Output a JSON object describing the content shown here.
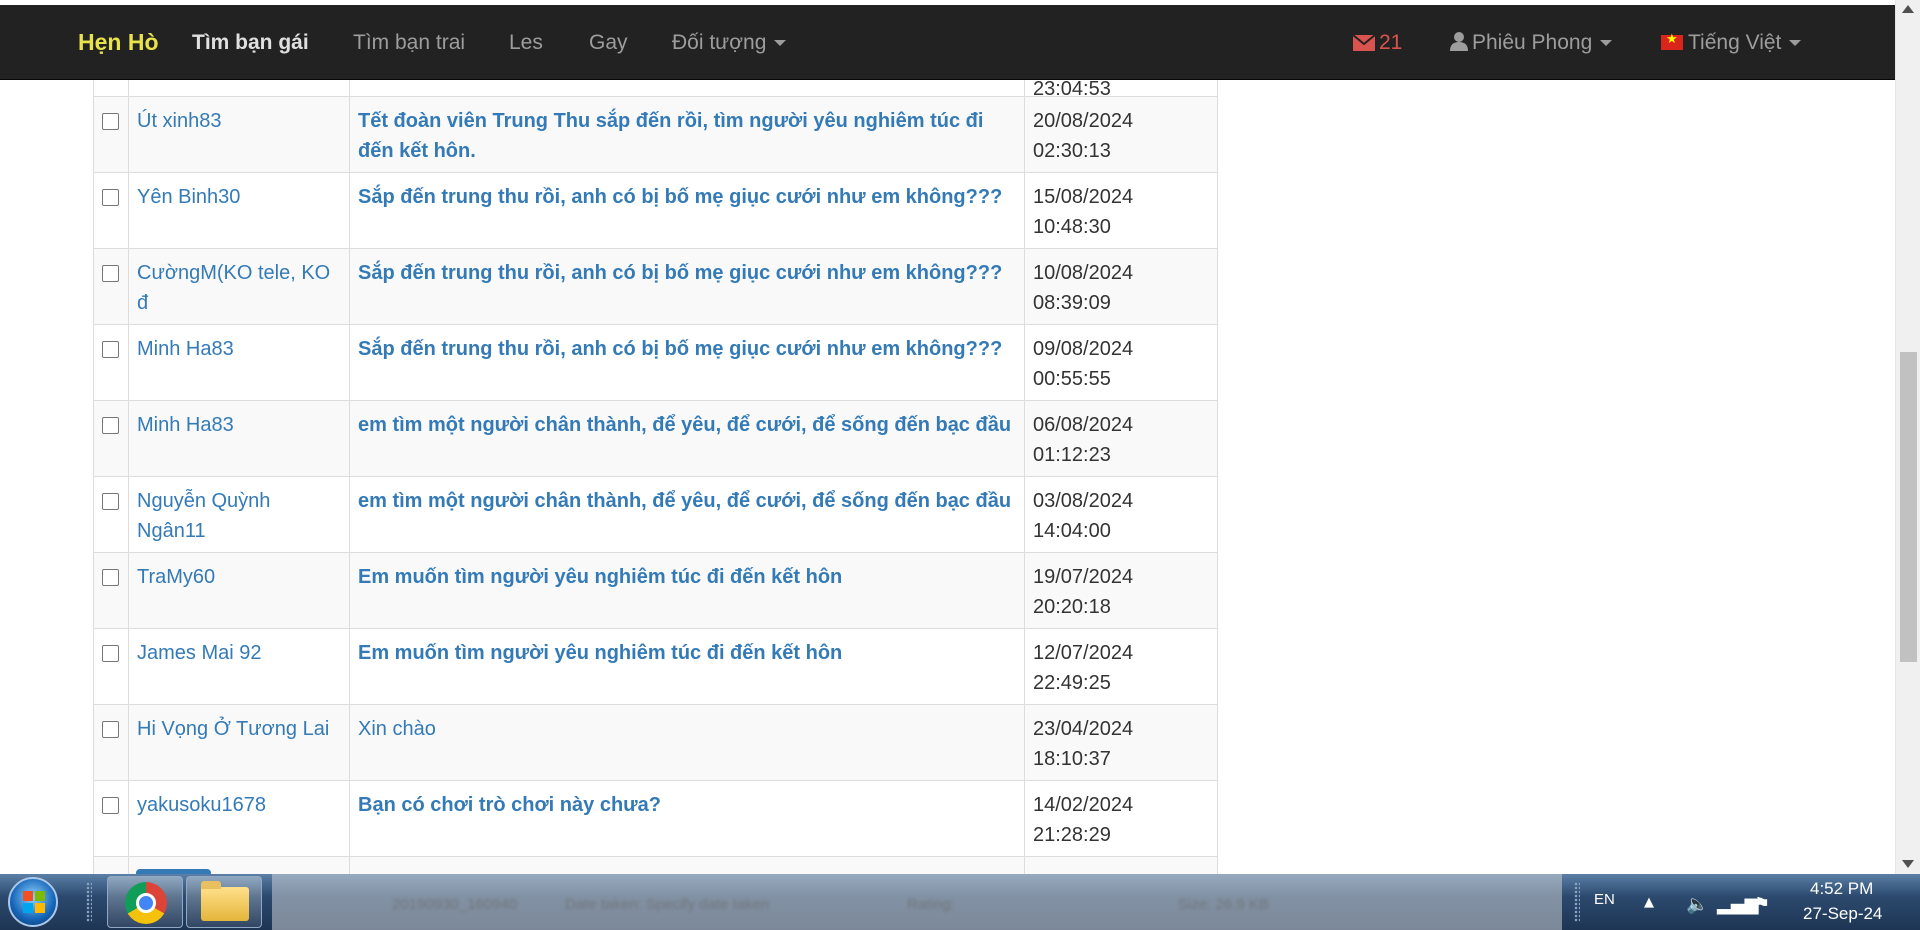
{
  "navbar": {
    "brand": "Hẹn Hò",
    "links": {
      "find_girlfriend": "Tìm bạn gái",
      "find_boyfriend": "Tìm bạn trai",
      "les": "Les",
      "gay": "Gay",
      "audience": "Đối tượng"
    },
    "mail_count": "21",
    "user_name": "Phiêu Phong",
    "language": "Tiếng Việt"
  },
  "messages": {
    "partial_top_date": "23:04:53",
    "rows": [
      {
        "sender": "Út xinh83",
        "subject": "Tết đoàn viên Trung Thu sắp đến rồi, tìm người yêu nghiêm túc đi đến kết hôn.",
        "date": "20/08/2024",
        "time": "02:30:13"
      },
      {
        "sender": "Yên Binh30",
        "subject": "Sắp đến trung thu rồi, anh có bị bố mẹ giục cưới như em không???",
        "date": "15/08/2024",
        "time": "10:48:30"
      },
      {
        "sender": "CườngM(KO tele, KO đ",
        "subject": "Sắp đến trung thu rồi, anh có bị bố mẹ giục cưới như em không???",
        "date": "10/08/2024",
        "time": "08:39:09"
      },
      {
        "sender": "Minh Ha83",
        "subject": "Sắp đến trung thu rồi, anh có bị bố mẹ giục cưới như em không???",
        "date": "09/08/2024",
        "time": "00:55:55"
      },
      {
        "sender": "Minh Ha83",
        "subject": "em tìm một người chân thành, để yêu, để cưới, để sống đến bạc đầu",
        "date": "06/08/2024",
        "time": "01:12:23"
      },
      {
        "sender": "Nguyễn Quỳnh Ngân11",
        "subject": "em tìm một người chân thành, để yêu, để cưới, để sống đến bạc đầu",
        "date": "03/08/2024",
        "time": "14:04:00"
      },
      {
        "sender": "TraMy60",
        "subject": "Em muốn tìm người yêu nghiêm túc đi đến kết hôn",
        "date": "19/07/2024",
        "time": "20:20:18"
      },
      {
        "sender": "James Mai 92",
        "subject": "Em muốn tìm người yêu nghiêm túc đi đến kết hôn",
        "date": "12/07/2024",
        "time": "22:49:25"
      },
      {
        "sender": "Hi Vọng Ở Tương Lai",
        "subject": "Xin chào",
        "date": "23/04/2024",
        "time": "18:10:37"
      },
      {
        "sender": "yakusoku1678",
        "subject": "Bạn có chơi trò chơi này chưa?",
        "date": "14/02/2024",
        "time": "21:28:29"
      }
    ]
  },
  "taskbar": {
    "blurred_filename": "20190930_160940",
    "blurred_label1": "Date taken: Specify date taken",
    "blurred_label2": "Rating:",
    "blurred_label3": "Size: 26.9 KB",
    "language": "EN",
    "time": "4:52 PM",
    "date": "27-Sep-24"
  },
  "colors": {
    "navbar_bg": "#222222",
    "brand": "#e8e24b",
    "link": "#337ab7",
    "mail": "#d9534f"
  }
}
